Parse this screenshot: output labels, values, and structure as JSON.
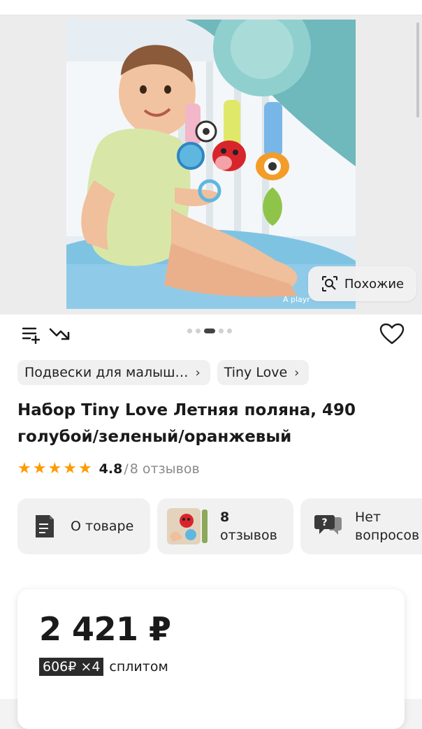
{
  "gallery": {
    "similar_label": "Похожие",
    "watermark": "A playr",
    "slide_dots": [
      false,
      false,
      true,
      false,
      false
    ]
  },
  "breadcrumbs": [
    {
      "label": "Подвески для малыш…"
    },
    {
      "label": "Tiny Love"
    }
  ],
  "product": {
    "title": "Набор Tiny Love Летняя поляна, 490 голубой/зеленый/оранжевый",
    "rating_value": "4.8",
    "rating_separator": "/",
    "reviews_text": "8 отзывов",
    "stars": 5
  },
  "info_cards": [
    {
      "label": "О товаре",
      "icon": "document-icon"
    },
    {
      "line1": "8",
      "line2": "отзывов",
      "icon": "review-thumbnail"
    },
    {
      "line1": "Нет",
      "line2": "вопросов",
      "icon": "question-bubble-icon"
    }
  ],
  "price": {
    "value": "2 421 ₽",
    "split_badge": "606₽ ×4",
    "split_label": "сплитом"
  },
  "colors": {
    "star": "#ff9a00",
    "badge_bg": "#2b2b2b"
  }
}
